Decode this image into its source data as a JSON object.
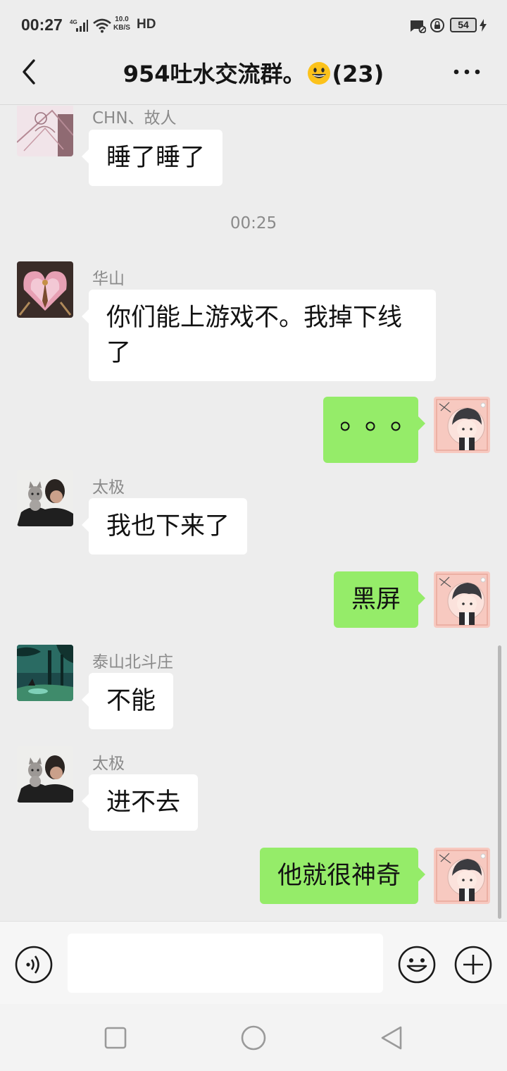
{
  "status_bar": {
    "time": "00:27",
    "network_type": "4G",
    "speed_value": "10.0",
    "speed_unit": "KB/S",
    "hd_label": "HD",
    "battery_level": "54"
  },
  "header": {
    "title": "954吐水交流群。",
    "title_emoji": "grinning-face-emoji",
    "member_count": "(23)"
  },
  "messages": [
    {
      "sender": "CHN、故人",
      "text": "睡了睡了",
      "side": "left",
      "avatar": "doodle-avatar"
    },
    {
      "timestamp": "00:25"
    },
    {
      "sender": "华山",
      "text": "你们能上游戏不。我掉下线了",
      "line1": "你们能上游戏不。我掉下线",
      "line2": "了",
      "side": "left",
      "avatar": "winged-emblem-avatar"
    },
    {
      "text": "。。。",
      "side": "right",
      "avatar": "anime-boy-avatar"
    },
    {
      "sender": "太极",
      "text": "我也下来了",
      "side": "left",
      "avatar": "boy-with-cat-avatar"
    },
    {
      "text": "黑屏",
      "side": "right",
      "avatar": "anime-boy-avatar"
    },
    {
      "sender": "泰山北斗庄",
      "text": "不能",
      "side": "left",
      "avatar": "jungle-scene-avatar"
    },
    {
      "sender": "太极",
      "text": "进不去",
      "side": "left",
      "avatar": "boy-with-cat-avatar"
    },
    {
      "text": "他就很神奇",
      "side": "right",
      "avatar": "anime-boy-avatar"
    }
  ],
  "input_bar": {
    "voice_icon": "voice-input-icon",
    "text_value": "",
    "emoji_icon": "smiley-icon",
    "plus_icon": "plus-icon"
  },
  "nav_bar": {
    "recents_icon": "square-icon",
    "home_icon": "circle-icon",
    "back_icon": "triangle-back-icon"
  },
  "colors": {
    "background": "#ededed",
    "bubble_self": "#95ec69",
    "bubble_other": "#ffffff",
    "meta_text": "#8a8a8a"
  }
}
